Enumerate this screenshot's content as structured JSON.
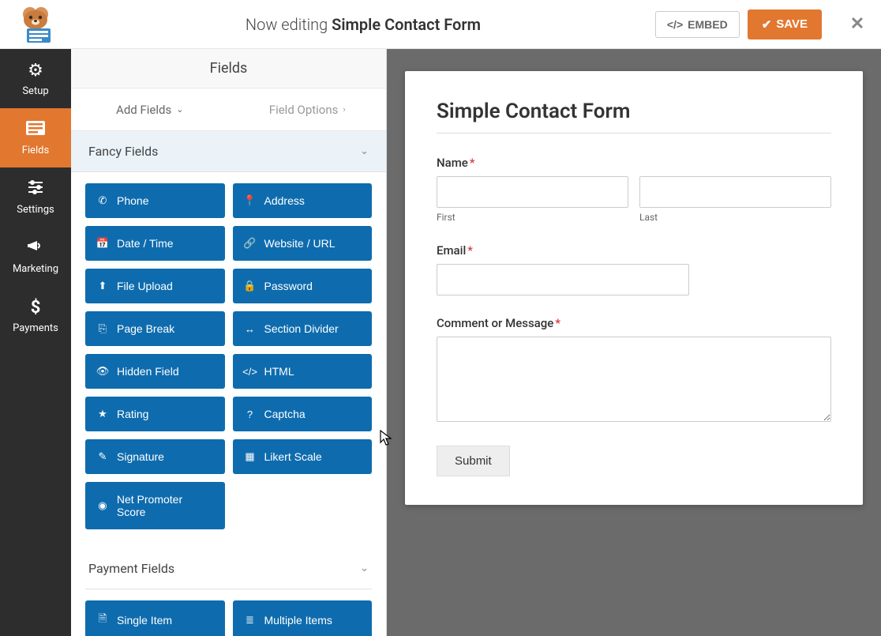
{
  "topbar": {
    "editing_prefix": "Now editing ",
    "form_name": "Simple Contact Form",
    "embed_label": "EMBED",
    "save_label": "SAVE"
  },
  "sidebar": {
    "items": [
      {
        "label": "Setup",
        "icon": "gear"
      },
      {
        "label": "Fields",
        "icon": "form"
      },
      {
        "label": "Settings",
        "icon": "sliders"
      },
      {
        "label": "Marketing",
        "icon": "bullhorn"
      },
      {
        "label": "Payments",
        "icon": "dollar"
      }
    ]
  },
  "panel": {
    "section_title": "Fields",
    "tabs": {
      "add_fields": "Add Fields",
      "field_options": "Field Options"
    },
    "groups": [
      {
        "title": "Fancy Fields",
        "fields": [
          {
            "label": "Phone",
            "icon": "phone"
          },
          {
            "label": "Address",
            "icon": "pin"
          },
          {
            "label": "Date / Time",
            "icon": "calendar"
          },
          {
            "label": "Website / URL",
            "icon": "link"
          },
          {
            "label": "File Upload",
            "icon": "upload"
          },
          {
            "label": "Password",
            "icon": "lock"
          },
          {
            "label": "Page Break",
            "icon": "pages"
          },
          {
            "label": "Section Divider",
            "icon": "arrows"
          },
          {
            "label": "Hidden Field",
            "icon": "eye"
          },
          {
            "label": "HTML",
            "icon": "code"
          },
          {
            "label": "Rating",
            "icon": "star"
          },
          {
            "label": "Captcha",
            "icon": "question"
          },
          {
            "label": "Signature",
            "icon": "pencil"
          },
          {
            "label": "Likert Scale",
            "icon": "grid"
          },
          {
            "label": "Net Promoter Score",
            "icon": "gauge"
          }
        ]
      },
      {
        "title": "Payment Fields",
        "fields": [
          {
            "label": "Single Item",
            "icon": "file"
          },
          {
            "label": "Multiple Items",
            "icon": "list"
          }
        ]
      }
    ]
  },
  "preview": {
    "form_title": "Simple Contact Form",
    "name_label": "Name",
    "first_sub": "First",
    "last_sub": "Last",
    "email_label": "Email",
    "comment_label": "Comment or Message",
    "submit_label": "Submit"
  }
}
